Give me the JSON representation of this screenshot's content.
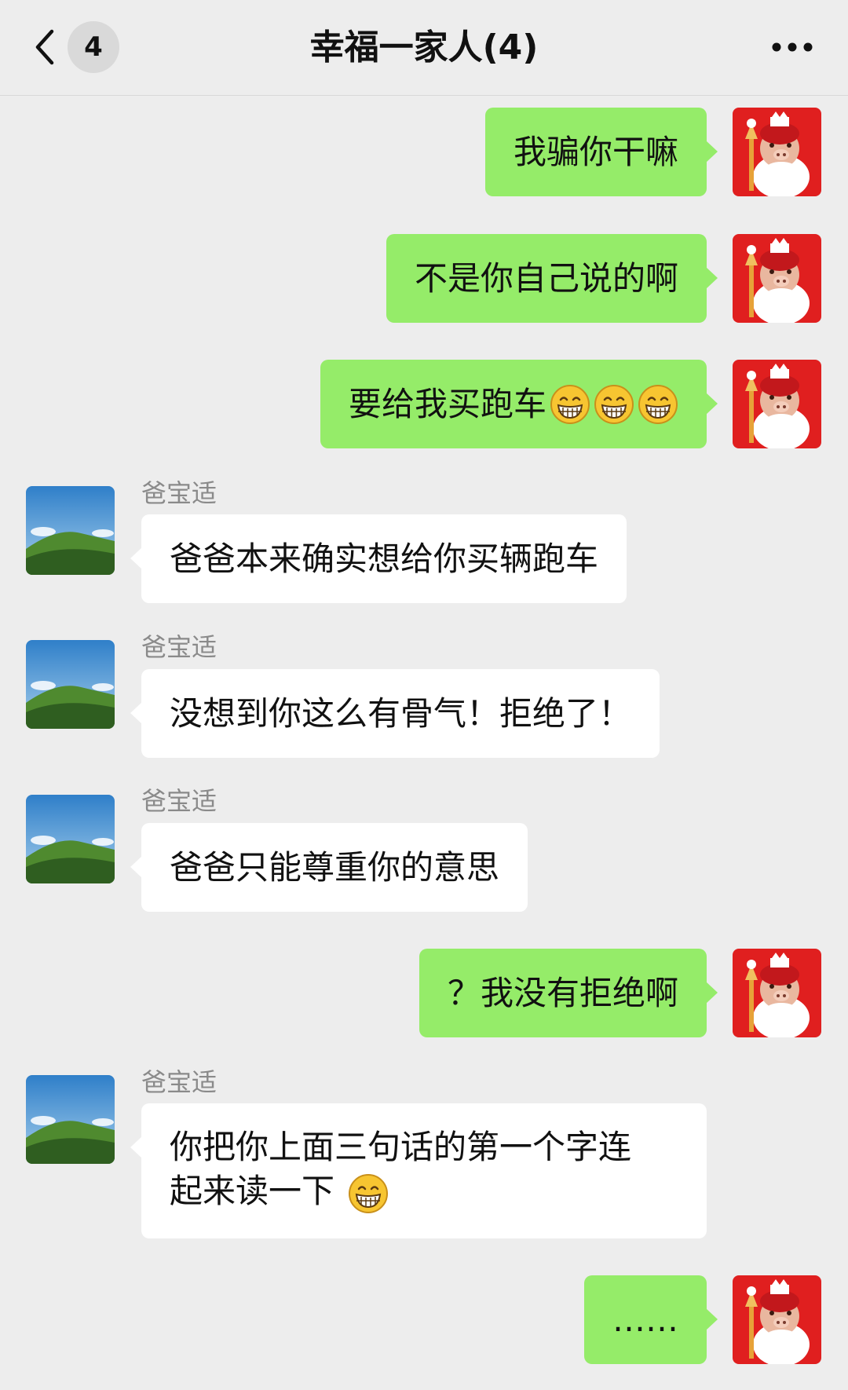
{
  "header": {
    "unread_count": "4",
    "title": "幸福一家人(4)"
  },
  "messages": [
    {
      "side": "right",
      "text": "我骗你干嘛"
    },
    {
      "side": "right",
      "text": "不是你自己说的啊"
    },
    {
      "side": "right",
      "text": "要给我买跑车",
      "emoji": [
        "grin-emoji",
        "grin-emoji",
        "grin-emoji"
      ]
    },
    {
      "side": "left",
      "sender": "爸宝适",
      "text": "爸爸本来确实想给你买辆跑车"
    },
    {
      "side": "left",
      "sender": "爸宝适",
      "text": "没想到你这么有骨气！拒绝了！"
    },
    {
      "side": "left",
      "sender": "爸宝适",
      "text": "爸爸只能尊重你的意思"
    },
    {
      "side": "right",
      "text": "？我没有拒绝啊"
    },
    {
      "side": "left",
      "sender": "爸宝适",
      "line1": "你把你上面三句话的第一个字连",
      "line2": "起来读一下",
      "emoji": [
        "grin-emoji"
      ]
    },
    {
      "side": "right",
      "text": "……"
    }
  ],
  "icons": {
    "back": "chevron-left-icon",
    "more": "more-dots-icon",
    "self_avatar": "cartoon-pig-avatar",
    "dad_avatar": "mountain-landscape-avatar"
  },
  "colors": {
    "background": "#ededed",
    "sent_bubble": "#95ec69",
    "received_bubble": "#ffffff",
    "self_avatar_bg": "#e01f1f"
  }
}
